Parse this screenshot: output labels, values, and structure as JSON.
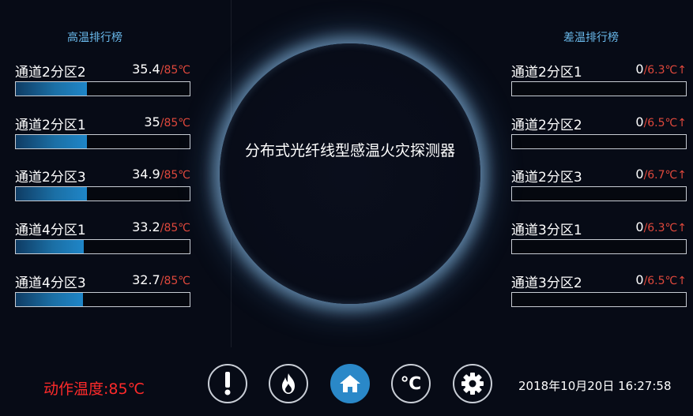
{
  "left_panel": {
    "title": "高温排行榜",
    "items": [
      {
        "label": "通道2分区2",
        "value": "35.4",
        "limit": "/85℃",
        "fill_fraction": 0.41
      },
      {
        "label": "通道2分区1",
        "value": "35",
        "limit": "/85℃",
        "fill_fraction": 0.41
      },
      {
        "label": "通道2分区3",
        "value": "34.9",
        "limit": "/85℃",
        "fill_fraction": 0.41
      },
      {
        "label": "通道4分区1",
        "value": "33.2",
        "limit": "/85℃",
        "fill_fraction": 0.39
      },
      {
        "label": "通道4分区3",
        "value": "32.7",
        "limit": "/85℃",
        "fill_fraction": 0.385
      }
    ]
  },
  "right_panel": {
    "title": "差温排行榜",
    "items": [
      {
        "label": "通道2分区1",
        "value": "0",
        "limit": "/6.3℃↑",
        "fill_fraction": 0
      },
      {
        "label": "通道2分区2",
        "value": "0",
        "limit": "/6.5℃↑",
        "fill_fraction": 0
      },
      {
        "label": "通道2分区3",
        "value": "0",
        "limit": "/6.7℃↑",
        "fill_fraction": 0
      },
      {
        "label": "通道3分区1",
        "value": "0",
        "limit": "/6.3℃↑",
        "fill_fraction": 0
      },
      {
        "label": "通道3分区2",
        "value": "0",
        "limit": "/6.5℃↑",
        "fill_fraction": 0
      }
    ]
  },
  "center": {
    "title": "分布式光纤线型感温火灾探测器"
  },
  "footer": {
    "action_temperature": "动作温度:85℃",
    "datetime": "2018年10月20日 16:27:58",
    "nav": [
      {
        "name": "alarm-button",
        "icon": "exclamation-icon",
        "active": false
      },
      {
        "name": "fire-button",
        "icon": "flame-icon",
        "active": false
      },
      {
        "name": "home-button",
        "icon": "home-icon",
        "active": true
      },
      {
        "name": "temperature-button",
        "icon": "celsius-icon",
        "text": "℃",
        "active": false
      },
      {
        "name": "settings-button",
        "icon": "gear-icon",
        "active": false
      }
    ]
  },
  "colors": {
    "accent": "#2a88c8",
    "limit_text": "#e0483c",
    "action_text": "#ff2a2a",
    "panel_title": "#69b8ea",
    "background": "#070b16"
  }
}
